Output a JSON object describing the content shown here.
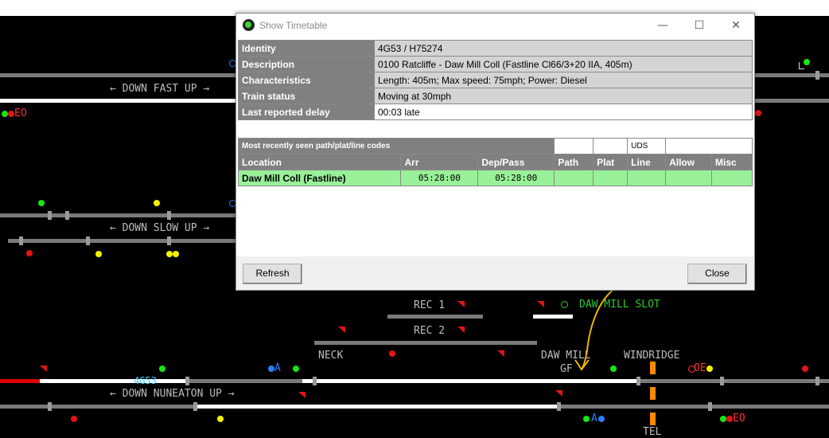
{
  "window": {
    "title": "Show Timetable",
    "minimize_glyph": "—",
    "maximize_glyph": "☐",
    "close_glyph": "✕"
  },
  "info": [
    {
      "label": "Identity",
      "value": "4G53 / H75274"
    },
    {
      "label": "Description",
      "value": "0100 Ratcliffe - Daw Mill Coll (Fastline Cl66/3+20 IIA, 405m)"
    },
    {
      "label": "Characteristics",
      "value": "Length: 405m; Max speed: 75mph; Power: Diesel"
    },
    {
      "label": "Train status",
      "value": "Moving at 30mph"
    },
    {
      "label": "Last reported delay",
      "value": "00:03 late"
    }
  ],
  "timetable": {
    "section_title": "Most recently seen path/plat/line codes",
    "seen_line_code": "UDS",
    "headers": [
      "Location",
      "Arr",
      "Dep/Pass",
      "Path",
      "Plat",
      "Line",
      "Allow",
      "Misc"
    ],
    "rows": [
      {
        "location": "Daw Mill Coll (Fastline)",
        "arr": "05:28:00",
        "dep": "05:28:00",
        "path": "",
        "plat": "",
        "line": "",
        "allow": "",
        "misc": ""
      }
    ]
  },
  "buttons": {
    "refresh": "Refresh",
    "close": "Close"
  },
  "sim": {
    "labels": {
      "down_fast_up": "← DOWN FAST UP →",
      "down_slow_up": "← DOWN SLOW UP →",
      "down_nuneaton_up": "← DOWN NUNEATON UP →",
      "rec1": "REC 1",
      "rec2": "REC 2",
      "neck": "NECK",
      "daw_mill": "DAW MILL",
      "gf": "GF",
      "windridge": "WINDRIDGE",
      "daw_mill_slot": "DAW MILL SLOT",
      "tel": "TEL",
      "train_headcode": "4G53",
      "eo_left": "EO",
      "oe_right": "OE",
      "eo_bottom": "EO",
      "a_left": "A",
      "a_bottom": "A"
    },
    "colors": {
      "occupied": "#e00000",
      "route_set": "#ffffff",
      "plain": "#7a7a7a",
      "headcode": "#44d0ff"
    }
  },
  "annotation": {
    "color": "#f0b400"
  }
}
